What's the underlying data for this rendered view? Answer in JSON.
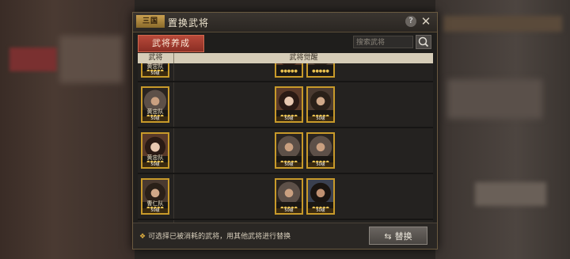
{
  "dialog": {
    "logo_text": "三国",
    "title": "置换武将",
    "help_label": "?",
    "close_label": "✕"
  },
  "tabs": {
    "active_label": "武将养成"
  },
  "search": {
    "placeholder": "搜索武将"
  },
  "columns": {
    "general": "武将",
    "awaken": "武将觉醒"
  },
  "rows": [
    {
      "name": "黄忠队",
      "stars": "●●●●●",
      "level": "50级",
      "face": "f-helmet",
      "awaken": [
        {
          "name": "",
          "stars": "●●●●●",
          "level": "",
          "face": "f-lady"
        },
        {
          "name": "",
          "stars": "●●●●●",
          "level": "",
          "face": "f-man"
        }
      ]
    },
    {
      "name": "黄忠队",
      "stars": "●●●●●",
      "level": "50级",
      "face": "f-helmet",
      "awaken": [
        {
          "name": "",
          "stars": "●●●●●",
          "level": "50级",
          "face": "f-lady"
        },
        {
          "name": "",
          "stars": "●●●●●",
          "level": "50级",
          "face": "f-man"
        }
      ]
    },
    {
      "name": "黄忠队",
      "stars": "●●●●●",
      "level": "50级",
      "face": "f-lady",
      "awaken": [
        {
          "name": "",
          "stars": "●●●●●",
          "level": "50级",
          "face": "f-helmet"
        },
        {
          "name": "",
          "stars": "●●●●●",
          "level": "50级",
          "face": "f-helmet"
        }
      ]
    },
    {
      "name": "曹仁队",
      "stars": "●●●●●",
      "level": "50级",
      "face": "f-man",
      "awaken": [
        {
          "name": "",
          "stars": "●●●●●",
          "level": "50级",
          "face": "f-helmet"
        },
        {
          "name": "",
          "stars": "●●●●●",
          "level": "50级",
          "face": "f-man2"
        }
      ]
    }
  ],
  "footer": {
    "hint_text": "可选择已被消耗的武将，用其他武将进行替换",
    "replace_icon": "⇆",
    "replace_label": "替换"
  }
}
